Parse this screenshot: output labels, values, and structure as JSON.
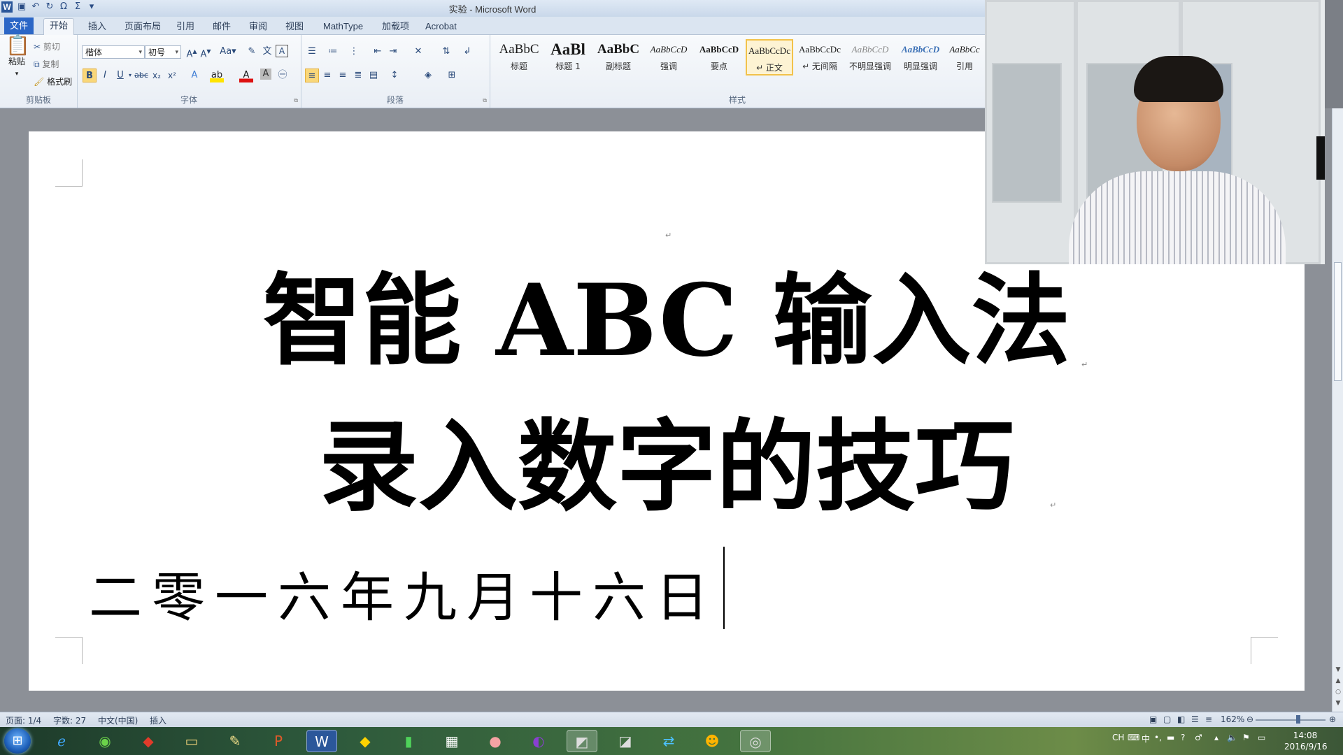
{
  "window": {
    "title": "实验 - Microsoft Word"
  },
  "tabs": [
    {
      "label": "文件"
    },
    {
      "label": "开始"
    },
    {
      "label": "插入"
    },
    {
      "label": "页面布局"
    },
    {
      "label": "引用"
    },
    {
      "label": "邮件"
    },
    {
      "label": "审阅"
    },
    {
      "label": "视图"
    },
    {
      "label": "MathType"
    },
    {
      "label": "加载项"
    },
    {
      "label": "Acrobat"
    }
  ],
  "clipboard": {
    "paste": "粘贴",
    "cut": "剪切",
    "copy": "复制",
    "format_painter": "格式刷",
    "label": "剪贴板"
  },
  "font": {
    "name": "楷体",
    "size": "初号",
    "label": "字体"
  },
  "paragraph": {
    "label": "段落"
  },
  "styles": {
    "label": "样式",
    "items": [
      {
        "sample": "AaBbC",
        "name": "标题"
      },
      {
        "sample": "AaBl",
        "name": "标题 1"
      },
      {
        "sample": "AaBbC",
        "name": "副标题"
      },
      {
        "sample": "AaBbCcD",
        "name": "强调"
      },
      {
        "sample": "AaBbCcD",
        "name": "要点"
      },
      {
        "sample": "AaBbCcDc",
        "name": "↵ 正文"
      },
      {
        "sample": "AaBbCcDc",
        "name": "↵ 无间隔"
      },
      {
        "sample": "AaBbCcD",
        "name": "不明显强调"
      },
      {
        "sample": "AaBbCcD",
        "name": "明显强调"
      },
      {
        "sample": "AaBbCc",
        "name": "引用"
      }
    ]
  },
  "document": {
    "line1": "智能 ABC 输入法",
    "line2": "录入数字的技巧",
    "line3": "二零一六年九月十六日",
    "para_mark": "↵"
  },
  "status": {
    "page": "页面: 1/4",
    "words": "字数: 27",
    "language": "中文(中国)",
    "mode": "插入",
    "zoom": "162%"
  },
  "taskbar": {
    "tray_lang": "CH",
    "tray_ime": "中",
    "time": "14:08",
    "date": "2016/9/16"
  }
}
